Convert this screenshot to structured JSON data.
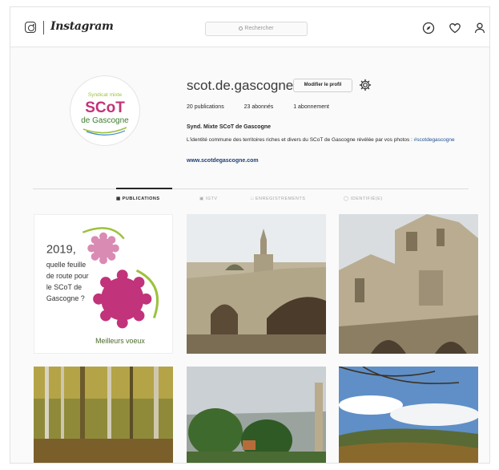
{
  "app": {
    "wordmark": "Instagram",
    "search_placeholder": "Rechercher"
  },
  "profile": {
    "username": "scot.de.gascogne",
    "edit_button": "Modifier le profil",
    "stats": {
      "publications": "20 publications",
      "followers": "23 abonnés",
      "following": "1 abonnement"
    },
    "bio_name": "Synd. Mixte SCoT de Gascogne",
    "bio_text": "L'identité commune des territoires riches et divers du SCoT de Gascogne révélée par vos photos :",
    "bio_hashtag": "#scotdegascogne",
    "website": "www.scotdegascogne.com",
    "avatar_logo": {
      "line1": "Syndicat mixte",
      "brand": "SCoT",
      "line3": "de Gascogne"
    }
  },
  "tabs": [
    {
      "label": "PUBLICATIONS",
      "active": true
    },
    {
      "label": "IGTV",
      "active": false
    },
    {
      "label": "ENREGISTREMENTS",
      "active": false
    },
    {
      "label": "IDENTIFIÉ(E)",
      "active": false
    }
  ],
  "posts": [
    {
      "kind": "greeting-card",
      "lines": [
        "2019,",
        "quelle feuille",
        "de route pour",
        "le SCoT de",
        "Gascogne ?"
      ],
      "footer": "Meilleurs voeux"
    },
    {
      "kind": "photo",
      "subject": "stone bridge and cathedral tower"
    },
    {
      "kind": "photo",
      "subject": "cathedral facade"
    },
    {
      "kind": "photo",
      "subject": "autumn forest"
    },
    {
      "kind": "photo",
      "subject": "trees and tower under grey sky"
    },
    {
      "kind": "photo",
      "subject": "hills landscape with clouds"
    }
  ],
  "colors": {
    "brand_magenta": "#c1337a",
    "brand_pink": "#d98bb3",
    "brand_green": "#9cc23c",
    "link_blue": "#1f3f73"
  },
  "icons": [
    "instagram-glyph-icon",
    "search-icon",
    "compass-icon",
    "heart-icon",
    "user-icon",
    "gear-icon",
    "grid-icon",
    "tv-icon",
    "bookmark-icon",
    "tag-icon"
  ]
}
